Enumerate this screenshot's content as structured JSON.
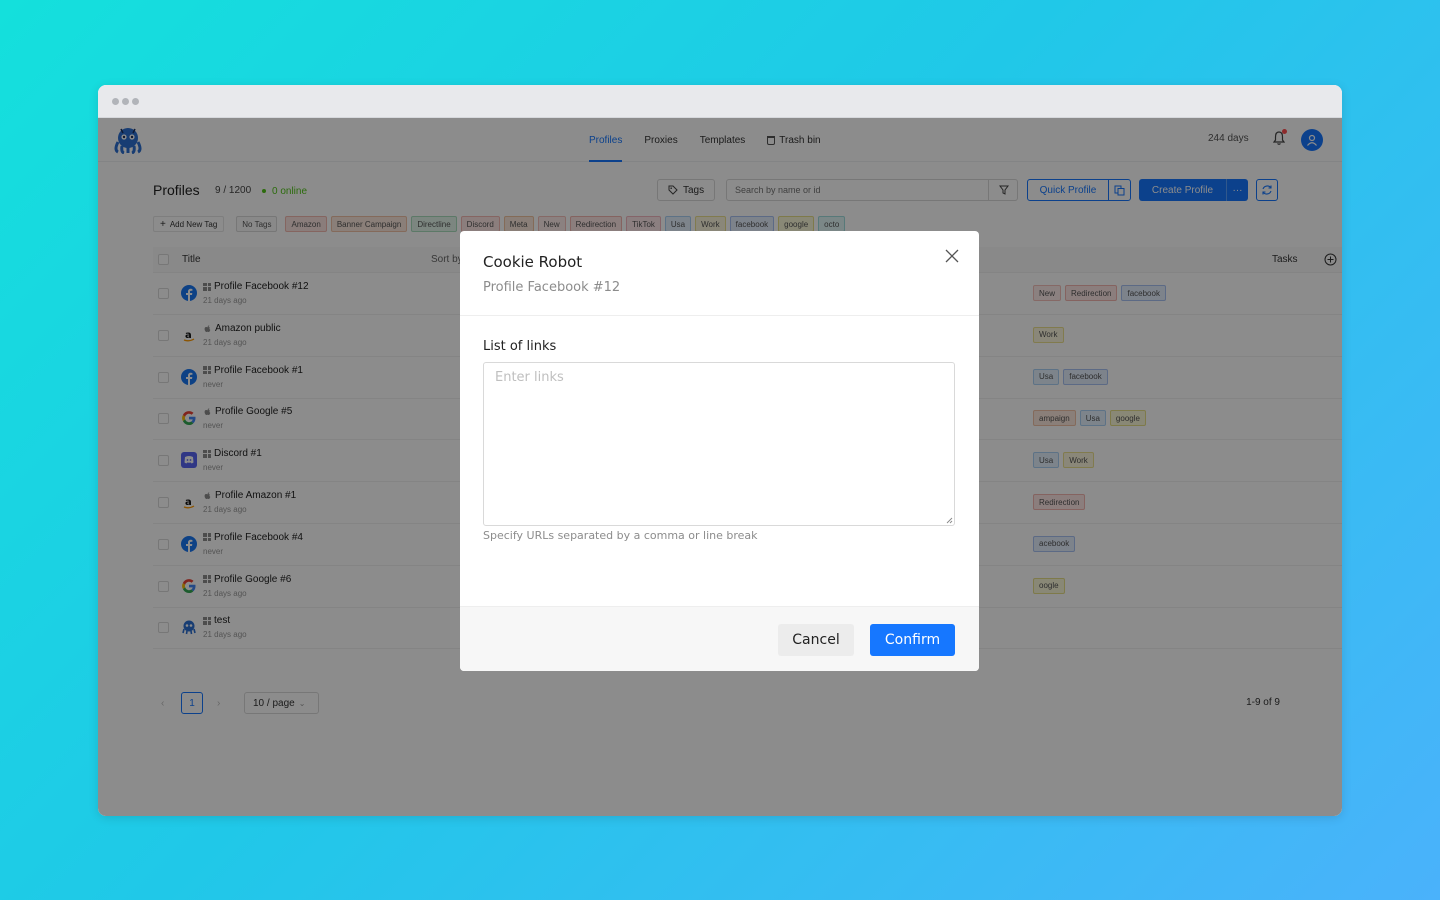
{
  "nav": {
    "tabs": [
      {
        "label": "Profiles",
        "active": true
      },
      {
        "label": "Proxies",
        "active": false
      },
      {
        "label": "Templates",
        "active": false
      },
      {
        "label": "Trash bin",
        "active": false
      }
    ],
    "days_left": "244 days"
  },
  "toolbar": {
    "title": "Profiles",
    "count": "9 / 1200",
    "online": "0 online",
    "tags_button": "Tags",
    "search_placeholder": "Search by name or id",
    "quick_profile": "Quick Profile",
    "create_profile": "Create Profile",
    "more": "···"
  },
  "tagbar": {
    "add_new_tag": "Add New Tag",
    "tags": [
      {
        "label": "No Tags",
        "color": "#fafafa",
        "border": "#d9d9d9"
      },
      {
        "label": "Amazon",
        "color": "#fbe3e0",
        "border": "#f2b8b0"
      },
      {
        "label": "Banner Campaign",
        "color": "#fbe7dc",
        "border": "#f1c2a6"
      },
      {
        "label": "Directline",
        "color": "#e2f5ea",
        "border": "#a8dcbc"
      },
      {
        "label": "Discord",
        "color": "#fde6e4",
        "border": "#f4b9b3"
      },
      {
        "label": "Meta",
        "color": "#fbe8da",
        "border": "#f0c39e"
      },
      {
        "label": "New",
        "color": "#fdecea",
        "border": "#f5c0ba"
      },
      {
        "label": "Redirection",
        "color": "#fde5e4",
        "border": "#f2b4b0"
      },
      {
        "label": "TikTok",
        "color": "#fde7ea",
        "border": "#f2b7c0"
      },
      {
        "label": "Usa",
        "color": "#e4f1fd",
        "border": "#a9cff5"
      },
      {
        "label": "Work",
        "color": "#fbf6dc",
        "border": "#ece08e"
      },
      {
        "label": "facebook",
        "color": "#e4eefd",
        "border": "#a8c2f2"
      },
      {
        "label": "google",
        "color": "#f9f7d8",
        "border": "#e5df87"
      },
      {
        "label": "octo",
        "color": "#e1f6f6",
        "border": "#9fdcdc"
      }
    ]
  },
  "table": {
    "headers": {
      "title": "Title",
      "sort": "Sort by",
      "tasks": "Tasks"
    },
    "rows": [
      {
        "name": "Profile Facebook #12",
        "time": "21 days ago",
        "icon": "facebook-icon",
        "os": "windows",
        "tags": [
          "New",
          "Redirection",
          "facebook"
        ]
      },
      {
        "name": "Amazon public",
        "time": "21 days ago",
        "icon": "amazon-icon",
        "os": "mac",
        "tags": [
          "Work"
        ]
      },
      {
        "name": "Profile Facebook #1",
        "time": "never",
        "icon": "facebook-icon",
        "os": "windows",
        "tags": [
          "Usa",
          "facebook"
        ]
      },
      {
        "name": "Profile Google #5",
        "time": "never",
        "icon": "google-icon",
        "os": "mac",
        "tags": [
          "ampaign",
          "Usa",
          "google"
        ]
      },
      {
        "name": "Discord #1",
        "time": "never",
        "icon": "discord-icon",
        "os": "windows",
        "tags": [
          "Usa",
          "Work"
        ]
      },
      {
        "name": "Profile Amazon #1",
        "time": "21 days ago",
        "icon": "amazon-icon",
        "os": "mac",
        "tags": [
          "Redirection"
        ]
      },
      {
        "name": "Profile Facebook #4",
        "time": "never",
        "icon": "facebook-icon",
        "os": "windows",
        "tags": [
          "acebook"
        ]
      },
      {
        "name": "Profile Google #6",
        "time": "21 days ago",
        "icon": "google-icon",
        "os": "windows",
        "tags": [
          "oogle"
        ]
      },
      {
        "name": "test",
        "time": "21 days ago",
        "icon": "octo-icon",
        "os": "windows",
        "tags": []
      }
    ]
  },
  "pagination": {
    "current": "1",
    "page_size": "10 / page",
    "total": "1-9 of 9"
  },
  "modal": {
    "title": "Cookie Robot",
    "subtitle": "Profile Facebook #12",
    "field_label": "List of links",
    "placeholder": "Enter links",
    "value": "",
    "hint": "Specify URLs separated by a comma or line break",
    "cancel": "Cancel",
    "confirm": "Confirm"
  },
  "colors": {
    "accent": "#1677ff",
    "online": "#52c41a",
    "overlay": "rgba(0,0,0,0.45)"
  }
}
